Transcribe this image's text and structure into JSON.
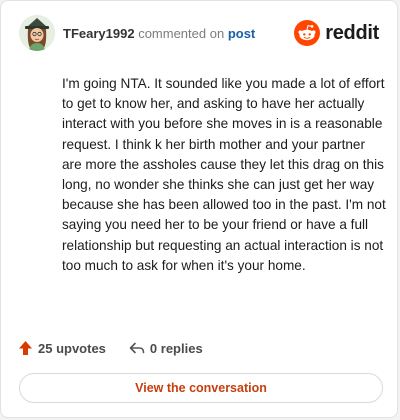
{
  "header": {
    "username": "TFeary1992",
    "commented": "commented on",
    "post_link": "post",
    "brand": "reddit"
  },
  "comment": {
    "body": "I'm going NTA. It sounded like you made a lot of effort to get to know her, and asking to have her actually interact with you before she moves in is a reasonable request. I think k her birth mother and your partner are more the assholes cause they let this drag on this long, no wonder she thinks she can just get her way because she has been allowed too in the past. I'm not saying you need her to be your friend or have a full relationship but requesting an actual interaction is not too much to ask for when it's your home."
  },
  "stats": {
    "upvotes": "25 upvotes",
    "replies": "0 replies"
  },
  "cta": {
    "label": "View the conversation"
  },
  "icons": {
    "avatar": "avatar",
    "brand_logo": "reddit-logo-icon",
    "upvote": "upvote-arrow-icon",
    "reply": "reply-arrow-icon"
  },
  "colors": {
    "brand_orange": "#ff4500",
    "upvote": "#d93a00",
    "cta_text": "#c73e0f",
    "post_link": "#1a5fa8"
  }
}
